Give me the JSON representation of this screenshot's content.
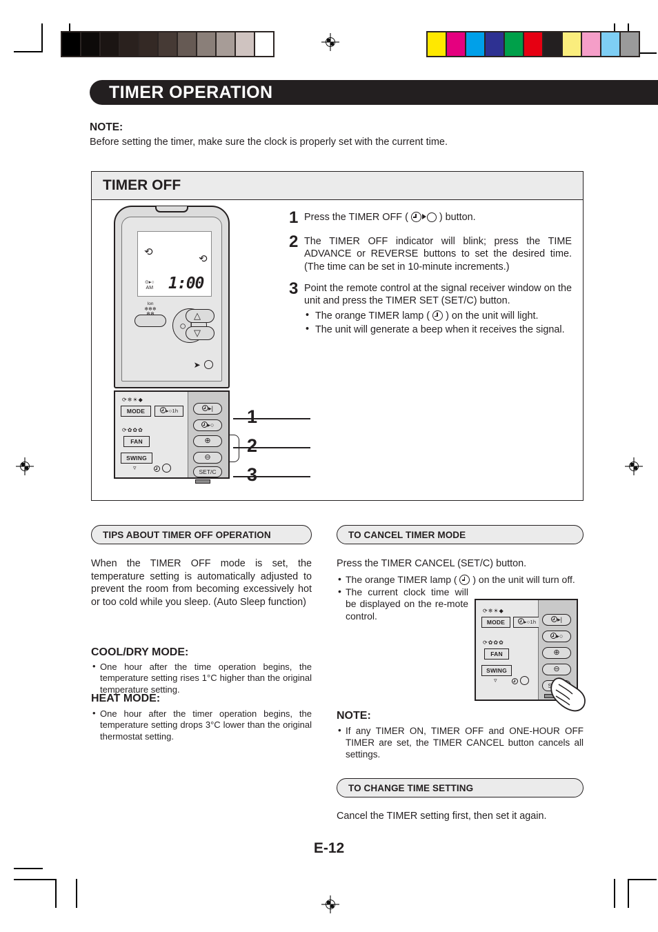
{
  "header": {
    "title": "TIMER OPERATION"
  },
  "note_top": {
    "label": "NOTE:",
    "text": "Before setting the timer, make sure the clock is properly set with the current time."
  },
  "main_section": {
    "title": "TIMER OFF",
    "steps": [
      {
        "num": "1",
        "text_before": "Press the TIMER OFF (",
        "text_after": ") button."
      },
      {
        "num": "2",
        "text": "The TIMER OFF indicator will blink; press the TIME ADVANCE or REVERSE buttons to set the desired time. (The time can be set in 10-minute increments.)"
      },
      {
        "num": "3",
        "text": "Point the remote control at the signal receiver window on the unit and press the TIMER SET (SET/C) button."
      }
    ],
    "step3_bullets_part1": "The orange TIMER lamp (",
    "step3_bullets_part2": ") on the unit will light.",
    "step3_bullet2": "The unit will generate a beep when it receives the signal.",
    "callouts": [
      "1",
      "2",
      "3"
    ]
  },
  "remote": {
    "lcd": {
      "am_line1": "⊙▸○",
      "am_line2": "AM",
      "time": "1:00"
    },
    "ion_label": "Ion",
    "power_glyph": "○ |",
    "mode_button": "MODE",
    "one_hour_button": "1h",
    "fan_button": "FAN",
    "swing_button": "SWING",
    "setc_button": "SET/C",
    "mode_symbols": "⟳❄☀◆",
    "fan_symbols": "⟳✿✿✿"
  },
  "tips": {
    "header": "TIPS ABOUT TIMER OFF OPERATION",
    "body": "When the TIMER OFF mode is set, the temperature setting  is automatically adjusted to prevent the room from becoming excessively  hot or too cold while you sleep. (Auto Sleep function)",
    "cool_dry_title": "COOL/DRY MODE:",
    "cool_dry_bullet": "One hour after the time operation begins, the temperature setting rises 1°C higher than the original temperature setting.",
    "heat_title": "HEAT MODE:",
    "heat_bullet": "One hour after the timer operation begins, the temperature setting drops 3°C lower than the original thermostat setting."
  },
  "cancel": {
    "header": "TO CANCEL TIMER MODE",
    "intro": "Press the TIMER CANCEL (SET/C) button.",
    "bullet1_part1": "The orange TIMER lamp (",
    "bullet1_part2": ") on the unit will turn off.",
    "bullet2": "The current clock time will be displayed on the re-mote control."
  },
  "note_bottom": {
    "label": "NOTE:",
    "bullet": "If any TIMER ON, TIMER OFF and ONE-HOUR OFF TIMER are set, the TIMER CANCEL button cancels all settings."
  },
  "change": {
    "header": "TO CHANGE TIME SETTING",
    "body": "Cancel the TIMER setting first, then set it again."
  },
  "page": {
    "number": "E-12"
  },
  "colors": {
    "ink": "#231f20",
    "grayscale_bar": [
      "#000000",
      "#0d0a09",
      "#1b1513",
      "#2a211e",
      "#342925",
      "#463a35",
      "#665a54",
      "#8a7f79",
      "#a79c97",
      "#cfc3c0",
      "#ffffff"
    ],
    "color_bar": [
      "#ffe800",
      "#e5007f",
      "#00a0e9",
      "#2e3192",
      "#00a04a",
      "#e60012",
      "#231f20",
      "#faed7d",
      "#f59ec8",
      "#7ecef4",
      "#9a9a9a"
    ]
  }
}
